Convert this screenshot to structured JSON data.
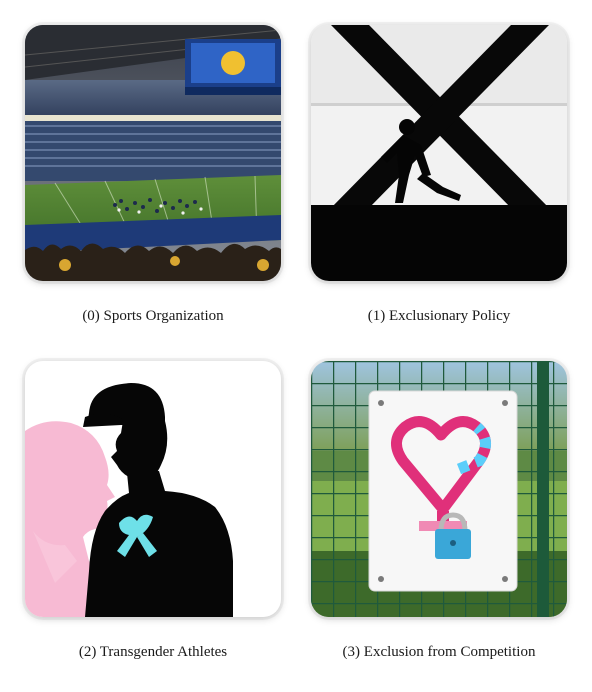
{
  "panels": [
    {
      "caption": "(0) Sports Organization",
      "image": "stadium-crowd-photo"
    },
    {
      "caption": "(1) Exclusionary Policy",
      "image": "runner-behind-x-silhouette"
    },
    {
      "caption": "(2) Transgender Athletes",
      "image": "athlete-silhouette-ribbon"
    },
    {
      "caption": "(3) Exclusion from Competition",
      "image": "locked-heart-sign-on-fence"
    }
  ],
  "colors": {
    "trans_pink": "#f5a9c8",
    "trans_blue": "#5bcefa",
    "heart_magenta": "#e0307a",
    "lock_blue": "#3aa7d8"
  }
}
